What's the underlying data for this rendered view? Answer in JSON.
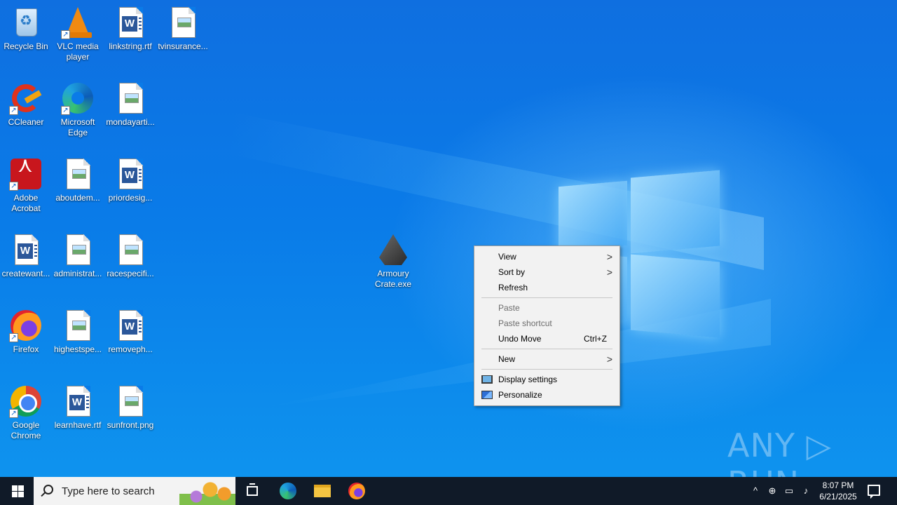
{
  "desktop": {
    "icons": [
      {
        "label": "Recycle Bin"
      },
      {
        "label": "VLC media player"
      },
      {
        "label": "linkstring.rtf"
      },
      {
        "label": "tvinsurance..."
      },
      {
        "label": "CCleaner"
      },
      {
        "label": "Microsoft Edge"
      },
      {
        "label": "mondayarti..."
      },
      {
        "label": "Adobe Acrobat"
      },
      {
        "label": "aboutdem..."
      },
      {
        "label": "priordesig..."
      },
      {
        "label": "createwant..."
      },
      {
        "label": "administrat..."
      },
      {
        "label": "racespecifi..."
      },
      {
        "label": "Firefox"
      },
      {
        "label": "highestspe..."
      },
      {
        "label": "removeph..."
      },
      {
        "label": "Google Chrome"
      },
      {
        "label": "learnhave.rtf"
      },
      {
        "label": "sunfront.png"
      },
      {
        "label": "Armoury Crate.exe"
      }
    ]
  },
  "context_menu": {
    "view": "View",
    "sort_by": "Sort by",
    "refresh": "Refresh",
    "paste": "Paste",
    "paste_shortcut": "Paste shortcut",
    "undo_move": "Undo Move",
    "undo_shortcut": "Ctrl+Z",
    "new": "New",
    "display_settings": "Display settings",
    "personalize": "Personalize"
  },
  "watermark": "ANY ▷ RUN",
  "taskbar": {
    "search_placeholder": "Type here to search",
    "time": "8:07 PM",
    "date": "6/21/2025",
    "colors": {
      "bar": "#101a28",
      "desktop": "#0a7be8"
    }
  }
}
